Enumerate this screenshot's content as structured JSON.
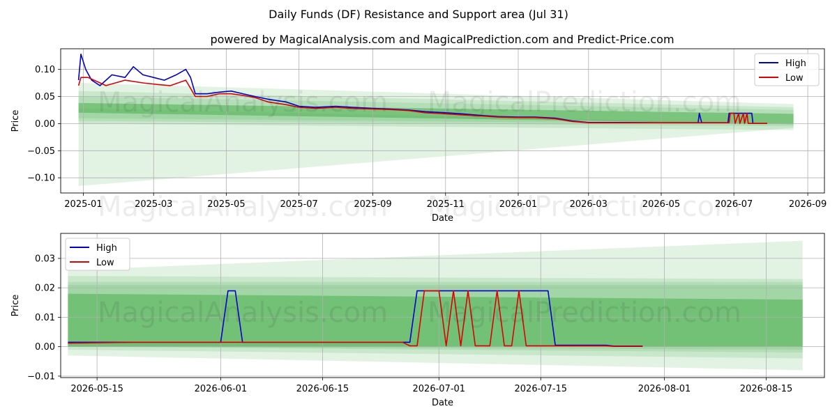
{
  "title": "Daily Funds (DF) Resistance and Support area (Jul 31)",
  "subtitle": "powered by MagicalAnalysis.com and MagicalPrediction.com and Predict-Price.com",
  "watermarks": [
    "MagicalAnalysis.com",
    "MagicalPrediction.com"
  ],
  "colors": {
    "high": "#0000cc",
    "low": "#dd0000",
    "band": "#4caf50",
    "grid": "#b0b0b0"
  },
  "chart_data": [
    {
      "type": "line",
      "xlabel": "Date",
      "ylabel": "Price",
      "xlim": [
        "2024-12-13",
        "2026-09-15"
      ],
      "ylim": [
        -0.128,
        0.138
      ],
      "xticks": [
        "2025-01",
        "2025-03",
        "2025-05",
        "2025-07",
        "2025-09",
        "2025-11",
        "2026-01",
        "2026-03",
        "2026-05",
        "2026-07",
        "2026-09"
      ],
      "yticks": [
        "0.10",
        "0.05",
        "0.00",
        "−0.05",
        "−0.10"
      ],
      "ytick_values": [
        0.1,
        0.05,
        0.0,
        -0.05,
        -0.1
      ],
      "grid": true,
      "legend": "top-right",
      "band": {
        "x": [
          "2024-12-28",
          "2026-08-20"
        ]
      },
      "series": [
        {
          "name": "High",
          "color": "#0000cc",
          "x": [
            "2024-12-28",
            "2024-12-30",
            "2025-01-03",
            "2025-01-08",
            "2025-01-15",
            "2025-01-25",
            "2025-02-05",
            "2025-02-12",
            "2025-02-20",
            "2025-03-01",
            "2025-03-10",
            "2025-03-20",
            "2025-03-28",
            "2025-04-01",
            "2025-04-05",
            "2025-04-15",
            "2025-04-25",
            "2025-05-05",
            "2025-05-15",
            "2025-05-25",
            "2025-06-05",
            "2025-06-20",
            "2025-07-01",
            "2025-07-15",
            "2025-08-01",
            "2025-08-15",
            "2025-09-01",
            "2025-09-15",
            "2025-10-01",
            "2025-10-15",
            "2025-11-01",
            "2025-11-15",
            "2025-12-01",
            "2025-12-15",
            "2026-01-01",
            "2026-01-15",
            "2026-02-01",
            "2026-02-15",
            "2026-03-01",
            "2026-04-01",
            "2026-05-01",
            "2026-06-01",
            "2026-06-02",
            "2026-06-04",
            "2026-06-26",
            "2026-06-27",
            "2026-07-16",
            "2026-07-17",
            "2026-07-29"
          ],
          "values": [
            0.08,
            0.128,
            0.1,
            0.08,
            0.07,
            0.09,
            0.085,
            0.105,
            0.09,
            0.085,
            0.08,
            0.09,
            0.1,
            0.085,
            0.055,
            0.055,
            0.058,
            0.06,
            0.055,
            0.05,
            0.045,
            0.04,
            0.032,
            0.03,
            0.032,
            0.03,
            0.028,
            0.027,
            0.025,
            0.022,
            0.02,
            0.018,
            0.015,
            0.013,
            0.012,
            0.012,
            0.01,
            0.005,
            0.002,
            0.002,
            0.0015,
            0.0015,
            0.019,
            0.0015,
            0.0015,
            0.019,
            0.019,
            0.0005,
            0.0002
          ]
        },
        {
          "name": "Low",
          "color": "#dd0000",
          "x": [
            "2024-12-28",
            "2024-12-30",
            "2025-01-05",
            "2025-01-20",
            "2025-02-05",
            "2025-02-20",
            "2025-03-05",
            "2025-03-15",
            "2025-03-28",
            "2025-04-01",
            "2025-04-05",
            "2025-04-15",
            "2025-04-25",
            "2025-05-05",
            "2025-05-15",
            "2025-05-25",
            "2025-06-05",
            "2025-06-20",
            "2025-07-01",
            "2025-07-15",
            "2025-08-01",
            "2025-08-15",
            "2025-09-01",
            "2025-09-15",
            "2025-10-01",
            "2025-10-15",
            "2025-11-01",
            "2025-11-15",
            "2025-12-01",
            "2025-12-15",
            "2026-01-01",
            "2026-01-15",
            "2026-02-01",
            "2026-02-15",
            "2026-03-01",
            "2026-04-01",
            "2026-05-01",
            "2026-06-01",
            "2026-06-27",
            "2026-06-28",
            "2026-07-01",
            "2026-07-02",
            "2026-07-05",
            "2026-07-06",
            "2026-07-09",
            "2026-07-10",
            "2026-07-12",
            "2026-07-13",
            "2026-07-29"
          ],
          "values": [
            0.07,
            0.085,
            0.085,
            0.07,
            0.08,
            0.075,
            0.072,
            0.07,
            0.08,
            0.065,
            0.05,
            0.05,
            0.055,
            0.055,
            0.052,
            0.048,
            0.04,
            0.035,
            0.03,
            0.028,
            0.03,
            0.028,
            0.027,
            0.026,
            0.024,
            0.02,
            0.018,
            0.016,
            0.014,
            0.012,
            0.011,
            0.011,
            0.009,
            0.004,
            0.0015,
            0.0015,
            0.0015,
            0.0015,
            0.0015,
            0.019,
            0.019,
            0.0003,
            0.019,
            0.0003,
            0.019,
            0.0003,
            0.019,
            0.0003,
            0.0002
          ]
        }
      ]
    },
    {
      "type": "line",
      "xlabel": "Date",
      "ylabel": "Price",
      "xlim": [
        "2026-05-10",
        "2026-08-23"
      ],
      "ylim": [
        -0.0105,
        0.0385
      ],
      "xticks": [
        "2026-05-15",
        "2026-06-01",
        "2026-06-15",
        "2026-07-01",
        "2026-07-15",
        "2026-08-01",
        "2026-08-15"
      ],
      "yticks": [
        "0.03",
        "0.02",
        "0.01",
        "0.00",
        "−0.01"
      ],
      "ytick_values": [
        0.03,
        0.02,
        0.01,
        0.0,
        -0.01
      ],
      "grid": true,
      "legend": "top-left",
      "band": {
        "x": [
          "2026-05-11",
          "2026-08-20"
        ]
      },
      "series": [
        {
          "name": "High",
          "color": "#0000cc",
          "x": [
            "2026-05-11",
            "2026-05-15",
            "2026-05-20",
            "2026-06-01",
            "2026-06-02",
            "2026-06-03",
            "2026-06-04",
            "2026-06-05",
            "2026-06-15",
            "2026-06-26",
            "2026-06-27",
            "2026-06-28",
            "2026-07-01",
            "2026-07-10",
            "2026-07-15",
            "2026-07-16",
            "2026-07-17",
            "2026-07-20",
            "2026-07-24",
            "2026-07-25",
            "2026-07-29"
          ],
          "values": [
            0.0015,
            0.0015,
            0.0015,
            0.0015,
            0.019,
            0.019,
            0.0015,
            0.0015,
            0.0015,
            0.0015,
            0.0015,
            0.019,
            0.019,
            0.019,
            0.019,
            0.019,
            0.0005,
            0.0005,
            0.0005,
            0.0002,
            0.0002
          ]
        },
        {
          "name": "Low",
          "color": "#dd0000",
          "x": [
            "2026-05-11",
            "2026-05-20",
            "2026-06-01",
            "2026-06-15",
            "2026-06-26",
            "2026-06-27",
            "2026-06-28",
            "2026-06-29",
            "2026-06-30",
            "2026-07-01",
            "2026-07-02",
            "2026-07-03",
            "2026-07-04",
            "2026-07-05",
            "2026-07-06",
            "2026-07-08",
            "2026-07-09",
            "2026-07-10",
            "2026-07-11",
            "2026-07-12",
            "2026-07-13",
            "2026-07-16",
            "2026-07-20",
            "2026-07-24",
            "2026-07-25",
            "2026-07-29"
          ],
          "values": [
            0.0012,
            0.0015,
            0.0015,
            0.0015,
            0.0015,
            0.0003,
            0.0003,
            0.019,
            0.019,
            0.019,
            0.0003,
            0.019,
            0.0003,
            0.019,
            0.0003,
            0.0003,
            0.019,
            0.0003,
            0.0003,
            0.019,
            0.0003,
            0.0003,
            0.0003,
            0.0003,
            0.0001,
            0.0001
          ]
        }
      ]
    }
  ]
}
